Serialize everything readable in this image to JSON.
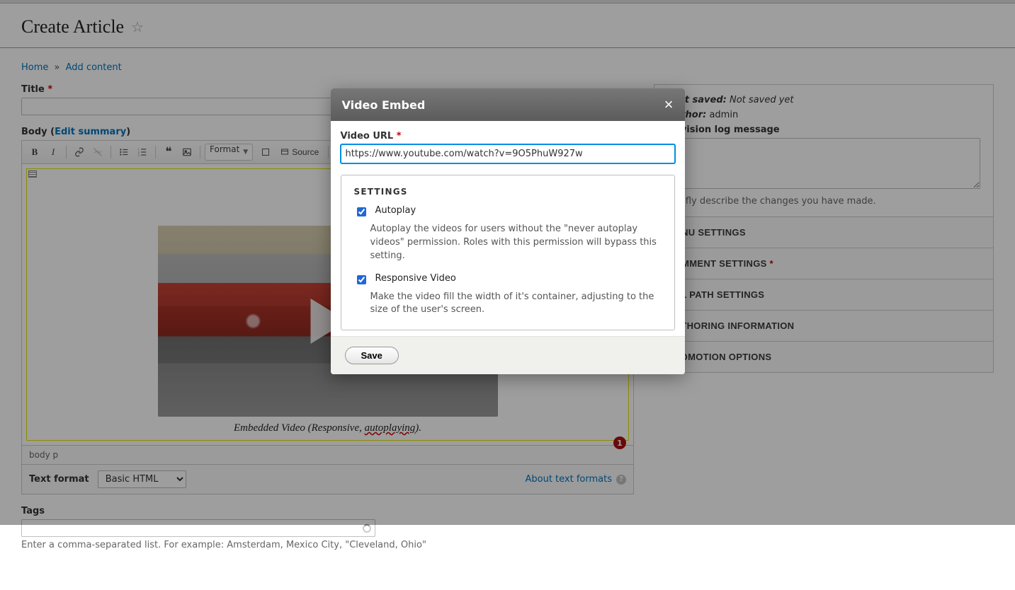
{
  "page": {
    "title": "Create Article",
    "breadcrumb": {
      "home": "Home",
      "add_content": "Add content",
      "sep": "»"
    }
  },
  "form": {
    "title_label": "Title",
    "body_label": "Body",
    "edit_summary": "Edit summary",
    "tags_label": "Tags",
    "tags_help": "Enter a comma-separated list. For example: Amsterdam, Mexico City, \"Cleveland, Ohio\"",
    "text_format_label": "Text format",
    "text_format_value": "Basic HTML",
    "about_formats": "About text formats"
  },
  "editor": {
    "format_select": "Format",
    "source_label": "Source",
    "path": "body   p",
    "caption_prefix": "Embedded Video (Responsive, ",
    "caption_underlined": "autoplaying",
    "caption_suffix": ").",
    "badge": "1"
  },
  "sidebar": {
    "last_saved_label": "Last saved:",
    "last_saved_value": "Not saved yet",
    "author_label": "Author:",
    "author_value": "admin",
    "revision_label": "Revision log message",
    "revision_help": "Briefly describe the changes you have made.",
    "tabs": {
      "menu": "Menu settings",
      "comment": "Comment settings",
      "url": "URL path settings",
      "authoring": "Authoring information",
      "promotion": "Promotion options"
    }
  },
  "modal": {
    "title": "Video Embed",
    "url_label": "Video URL",
    "url_value": "https://www.youtube.com/watch?v=9O5PhuW927w",
    "settings_legend": "Settings",
    "autoplay_label": "Autoplay",
    "autoplay_help": "Autoplay the videos for users without the \"never autoplay videos\" permission. Roles with this permission will bypass this setting.",
    "responsive_label": "Responsive Video",
    "responsive_help": "Make the video fill the width of it's container, adjusting to the size of the user's screen.",
    "save_label": "Save"
  }
}
